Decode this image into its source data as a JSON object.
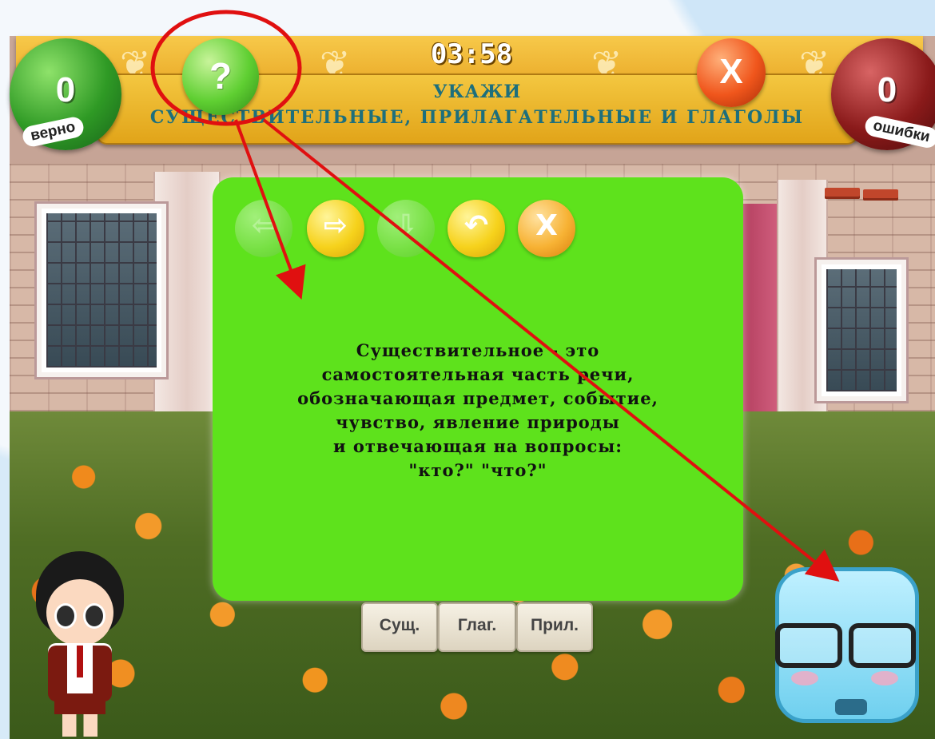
{
  "game": {
    "timer": "03:58",
    "title_line1": "УКАЖИ",
    "title_line2": "СУЩЕСТВИТЕЛЬНЫЕ, ПРИЛАГАТЕЛЬНЫЕ И ГЛАГОЛЫ",
    "help_symbol": "?",
    "close_symbol": "X"
  },
  "scores": {
    "correct": {
      "value": "0",
      "label": "верно"
    },
    "errors": {
      "value": "0",
      "label": "ошибки"
    }
  },
  "panel": {
    "nav": {
      "back": "⇦",
      "forward": "⇨",
      "down": "⇩",
      "undo": "↶",
      "close": "X"
    },
    "definition_lines": [
      "Существительное - это",
      "самостоятельная часть речи,",
      "обозначающая предмет, событие,",
      "чувство, явление природы",
      "и отвечающая на вопросы:",
      "\"кто?\" \"что?\""
    ]
  },
  "answers": {
    "noun": "Сущ.",
    "verb": "Глаг.",
    "adjective": "Прил."
  },
  "colors": {
    "panel_green": "#5ee21c",
    "banner_gold": "#e9a826",
    "title_teal": "#1d6f7c",
    "annotation_red": "#e01010"
  },
  "icons": {
    "help": "question-icon",
    "close": "close-icon",
    "back": "arrow-left-icon",
    "forward": "arrow-right-icon",
    "down": "arrow-down-icon",
    "undo": "undo-icon"
  }
}
